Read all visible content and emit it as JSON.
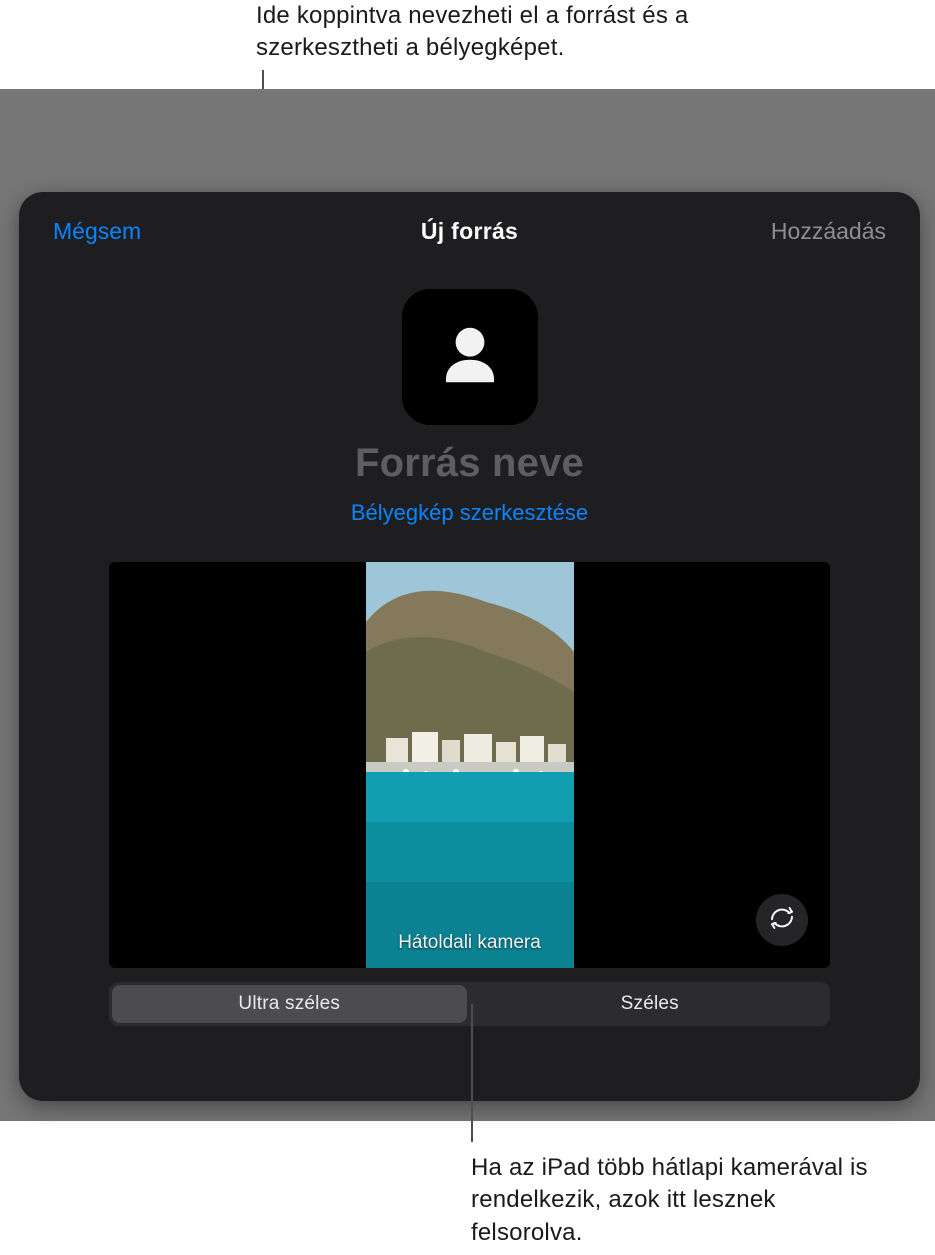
{
  "callouts": {
    "top": "Ide koppintva nevezheti el a forrást és a szerkesztheti a bélyegképet.",
    "bottom": "Ha az iPad több hátlapi kamerával is rendelkezik, azok itt lesznek felsorolva."
  },
  "header": {
    "cancel": "Mégsem",
    "title": "Új forrás",
    "add": "Hozzáadás"
  },
  "source": {
    "name_placeholder": "Forrás neve",
    "edit_thumbnail": "Bélyegkép szerkesztése"
  },
  "preview": {
    "camera_label": "Hátoldali kamera"
  },
  "segmented": {
    "ultrawide": "Ultra széles",
    "wide": "Széles"
  },
  "icons": {
    "avatar": "person-icon",
    "flip": "camera-flip-icon"
  },
  "colors": {
    "accent": "#0a84ff",
    "panel_bg": "#1e1e20",
    "outer_bg": "#767676"
  }
}
